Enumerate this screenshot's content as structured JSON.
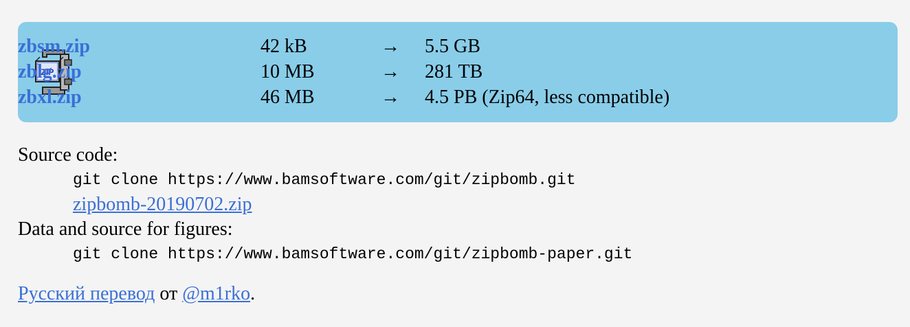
{
  "downloads": {
    "rows": [
      {
        "file": "zbsm.zip",
        "size": "42 kB",
        "arrow": "→",
        "result": "5.5 GB"
      },
      {
        "file": "zblg.zip",
        "size": "10 MB",
        "arrow": "→",
        "result": "281 TB"
      },
      {
        "file": "zbxl.zip",
        "size": "46 MB",
        "arrow": "→",
        "result": "4.5 PB (Zip64, less compatible)"
      }
    ],
    "icon_label": "ZIP",
    "icon": "zip-archive-icon"
  },
  "source": {
    "heading": "Source code:",
    "git_command": "git clone https://www.bamsoftware.com/git/zipbomb.git",
    "archive_link": "zipbomb-20190702.zip",
    "figures_heading": "Data and source for figures:",
    "figures_git_command": "git clone https://www.bamsoftware.com/git/zipbomb-paper.git"
  },
  "translation": {
    "link_text": "Русский перевод",
    "connector": " от ",
    "author_link": "@m1rko",
    "period": "."
  },
  "colors": {
    "box_background": "#89cde9",
    "page_background": "#f4f4f4",
    "link": "#3b6fd6"
  }
}
